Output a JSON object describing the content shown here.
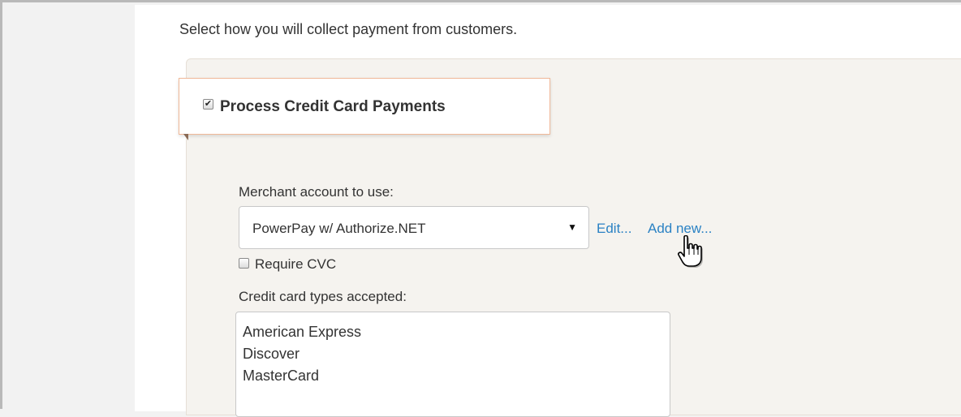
{
  "intro_text": "Select how you will collect payment from customers.",
  "credit_card_section": {
    "enabled": true,
    "heading": "Process Credit Card Payments",
    "merchant_label": "Merchant account to use:",
    "merchant_selected": "PowerPay w/ Authorize.NET",
    "edit_link": "Edit...",
    "add_new_link": "Add new...",
    "require_cvc": {
      "checked": false,
      "label": "Require CVC"
    },
    "card_types_label": "Credit card types accepted:",
    "card_types": [
      "American Express",
      "Discover",
      "MasterCard"
    ]
  },
  "colors": {
    "link": "#2b82c4",
    "panel_background": "#f5f3ef",
    "heading_border": "#f0b898"
  },
  "icons": {
    "select_arrow": "triangle-down-icon",
    "cursor": "hand-pointer-icon"
  }
}
